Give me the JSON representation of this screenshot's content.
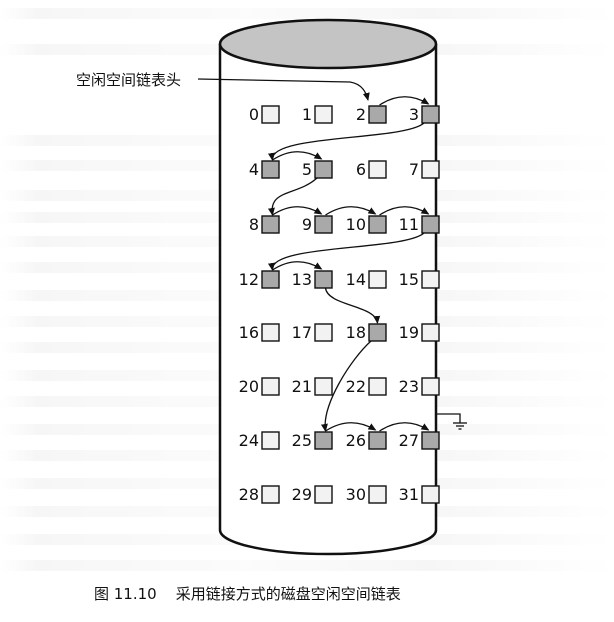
{
  "figure": {
    "head_label": "空闲空间链表头",
    "caption": "图 11.10    采用链接方式的磁盘空闲空间链表",
    "colors": {
      "free_block": "#a9a9a9",
      "used_block": "#f2f2f2",
      "outline": "#111111",
      "cylinder_top": "#c4c4c4",
      "bleed_text": "#b4b4b4"
    }
  },
  "blocks": [
    {
      "label": "0",
      "free": false
    },
    {
      "label": "1",
      "free": false
    },
    {
      "label": "2",
      "free": true
    },
    {
      "label": "3",
      "free": true
    },
    {
      "label": "4",
      "free": true
    },
    {
      "label": "5",
      "free": true
    },
    {
      "label": "6",
      "free": false
    },
    {
      "label": "7",
      "free": false
    },
    {
      "label": "8",
      "free": true
    },
    {
      "label": "9",
      "free": true
    },
    {
      "label": "10",
      "free": true
    },
    {
      "label": "11",
      "free": true
    },
    {
      "label": "12",
      "free": true
    },
    {
      "label": "13",
      "free": true
    },
    {
      "label": "14",
      "free": false
    },
    {
      "label": "15",
      "free": false
    },
    {
      "label": "16",
      "free": false
    },
    {
      "label": "17",
      "free": false
    },
    {
      "label": "18",
      "free": true
    },
    {
      "label": "19",
      "free": false
    },
    {
      "label": "20",
      "free": false
    },
    {
      "label": "21",
      "free": false
    },
    {
      "label": "22",
      "free": false
    },
    {
      "label": "23",
      "free": false
    },
    {
      "label": "24",
      "free": false
    },
    {
      "label": "25",
      "free": true
    },
    {
      "label": "26",
      "free": true
    },
    {
      "label": "27",
      "free": true
    },
    {
      "label": "28",
      "free": false
    },
    {
      "label": "29",
      "free": false
    },
    {
      "label": "30",
      "free": false
    },
    {
      "label": "31",
      "free": false
    }
  ],
  "free_list_order": [
    2,
    3,
    4,
    5,
    8,
    9,
    10,
    11,
    12,
    13,
    18,
    25,
    26,
    27
  ]
}
